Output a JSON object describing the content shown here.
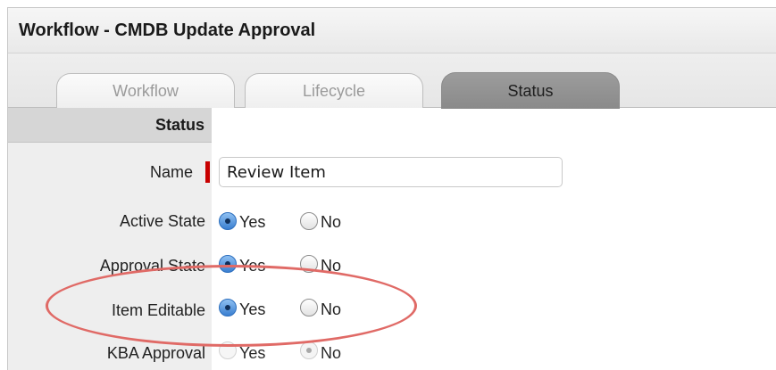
{
  "window": {
    "title": "Workflow - CMDB Update Approval"
  },
  "tabs": [
    {
      "label": "Workflow",
      "active": false
    },
    {
      "label": "Lifecycle",
      "active": false
    },
    {
      "label": "Status",
      "active": true
    }
  ],
  "form": {
    "section_title": "Status",
    "name": {
      "label": "Name",
      "value": "Review Item",
      "required": true
    },
    "active_state": {
      "label": "Active State",
      "yes": "Yes",
      "no": "No",
      "selected": "Yes"
    },
    "approval_state": {
      "label": "Approval State",
      "yes": "Yes",
      "no": "No",
      "selected": "Yes"
    },
    "item_editable": {
      "label": "Item Editable",
      "yes": "Yes",
      "no": "No",
      "selected": "Yes"
    },
    "kba_approval": {
      "label": "KBA Approval",
      "yes": "Yes",
      "no": "No",
      "selected": "No",
      "disabled": true
    }
  },
  "colors": {
    "highlight_ellipse": "#e06a66",
    "required_marker": "#c80000",
    "radio_selected": "#3a7fd0"
  }
}
